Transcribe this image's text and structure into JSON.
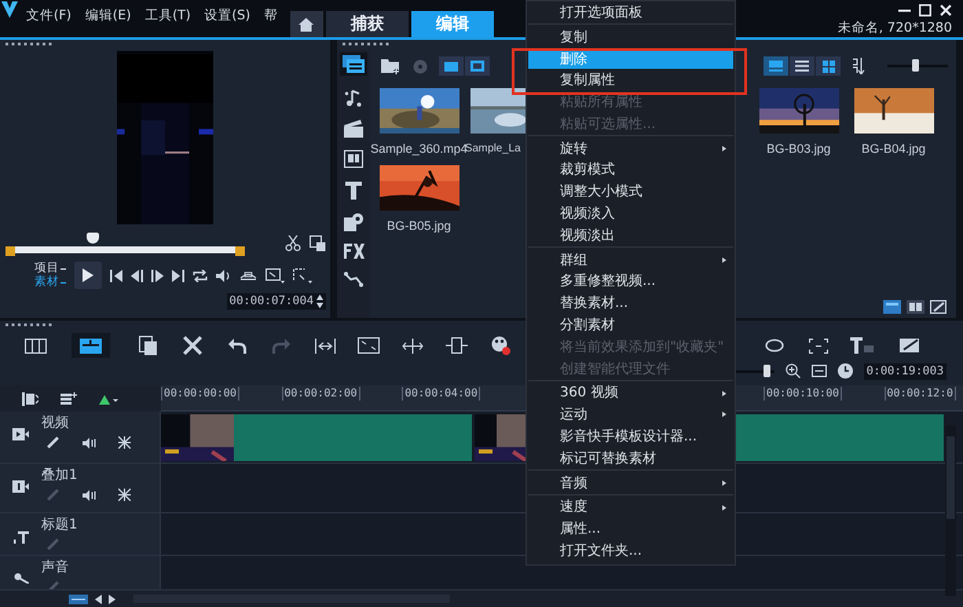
{
  "window": {
    "title": "未命名, 720*1280"
  },
  "menu_bar": [
    "文件(F)",
    "编辑(E)",
    "工具(T)",
    "设置(S)",
    "帮"
  ],
  "tabs": [
    {
      "label": "捕获",
      "selected": false
    },
    {
      "label": "编辑",
      "selected": true
    }
  ],
  "player": {
    "scrub": {
      "level": 0.36
    },
    "modes": [
      {
        "label": "项目",
        "selected": false
      },
      {
        "label": "素材",
        "selected": true
      }
    ],
    "timecode": "00:00:07:004"
  },
  "library": {
    "zoom": {
      "level": 0.45
    },
    "items": [
      {
        "label": "Sample_360.mp4",
        "kind": "picture"
      },
      {
        "label": "Sample_La",
        "kind": "picture"
      },
      {
        "label": "BG-B03.jpg",
        "kind": "picture"
      },
      {
        "label": "BG-B04.jpg",
        "kind": "picture"
      },
      {
        "label": "BG-B05.jpg",
        "kind": "picture"
      }
    ]
  },
  "timeline": {
    "view_buttons": [
      {
        "kind": "storyboard",
        "selected": false
      },
      {
        "kind": "timeline",
        "selected": true
      }
    ],
    "history": [
      {
        "kind": "undo",
        "disabled": false
      },
      {
        "kind": "redo",
        "disabled": true
      }
    ],
    "zoom": {
      "level": 0.93
    },
    "timecode": "0:00:19:003",
    "ruler": [
      "00:00:00:00",
      "00:00:02:00",
      "00:00:04:00",
      "00:00:10:00",
      "00:00:12:0"
    ],
    "tracks": [
      {
        "name": "视频",
        "kind": "video"
      },
      {
        "name": "叠加1",
        "kind": "overlay"
      },
      {
        "name": "标题1",
        "kind": "title"
      },
      {
        "name": "声音",
        "kind": "voice"
      }
    ]
  },
  "context_menu": {
    "items": [
      {
        "kind": "item",
        "label": "打开选项面板",
        "disabled": false,
        "selected": false,
        "submenu": false
      },
      {
        "kind": "separator"
      },
      {
        "kind": "item",
        "label": "复制",
        "disabled": false,
        "selected": false,
        "submenu": false
      },
      {
        "kind": "item",
        "label": "删除",
        "disabled": false,
        "selected": true,
        "submenu": false
      },
      {
        "kind": "item",
        "label": "复制属性",
        "disabled": false,
        "selected": false,
        "submenu": false
      },
      {
        "kind": "item",
        "label": "粘贴所有属性",
        "disabled": true,
        "selected": false,
        "submenu": false
      },
      {
        "kind": "item",
        "label": "粘贴可选属性...",
        "disabled": true,
        "selected": false,
        "submenu": false
      },
      {
        "kind": "separator"
      },
      {
        "kind": "item",
        "label": "旋转",
        "disabled": false,
        "selected": false,
        "submenu": true
      },
      {
        "kind": "item",
        "label": "裁剪模式",
        "disabled": false,
        "selected": false,
        "submenu": false
      },
      {
        "kind": "item",
        "label": "调整大小模式",
        "disabled": false,
        "selected": false,
        "submenu": false
      },
      {
        "kind": "item",
        "label": "视频淡入",
        "disabled": false,
        "selected": false,
        "submenu": false
      },
      {
        "kind": "item",
        "label": "视频淡出",
        "disabled": false,
        "selected": false,
        "submenu": false
      },
      {
        "kind": "separator"
      },
      {
        "kind": "item",
        "label": "群组",
        "disabled": false,
        "selected": false,
        "submenu": true
      },
      {
        "kind": "item",
        "label": "多重修整视频...",
        "disabled": false,
        "selected": false,
        "submenu": false
      },
      {
        "kind": "item",
        "label": "替换素材...",
        "disabled": false,
        "selected": false,
        "submenu": false
      },
      {
        "kind": "item",
        "label": "分割素材",
        "disabled": false,
        "selected": false,
        "submenu": false
      },
      {
        "kind": "item",
        "label": "将当前效果添加到\"收藏夹\"",
        "disabled": true,
        "selected": false,
        "submenu": false
      },
      {
        "kind": "item",
        "label": "创建智能代理文件",
        "disabled": true,
        "selected": false,
        "submenu": false
      },
      {
        "kind": "separator"
      },
      {
        "kind": "item",
        "label": "360 视频",
        "disabled": false,
        "selected": false,
        "submenu": true
      },
      {
        "kind": "item",
        "label": "运动",
        "disabled": false,
        "selected": false,
        "submenu": true
      },
      {
        "kind": "item",
        "label": "影音快手模板设计器...",
        "disabled": false,
        "selected": false,
        "submenu": false
      },
      {
        "kind": "item",
        "label": "标记可替换素材",
        "disabled": false,
        "selected": false,
        "submenu": false
      },
      {
        "kind": "separator"
      },
      {
        "kind": "item",
        "label": "音频",
        "disabled": false,
        "selected": false,
        "submenu": true
      },
      {
        "kind": "separator"
      },
      {
        "kind": "item",
        "label": "速度",
        "disabled": false,
        "selected": false,
        "submenu": true
      },
      {
        "kind": "item",
        "label": "属性...",
        "disabled": false,
        "selected": false,
        "submenu": false
      },
      {
        "kind": "item",
        "label": "打开文件夹...",
        "disabled": false,
        "selected": false,
        "submenu": false
      }
    ]
  }
}
